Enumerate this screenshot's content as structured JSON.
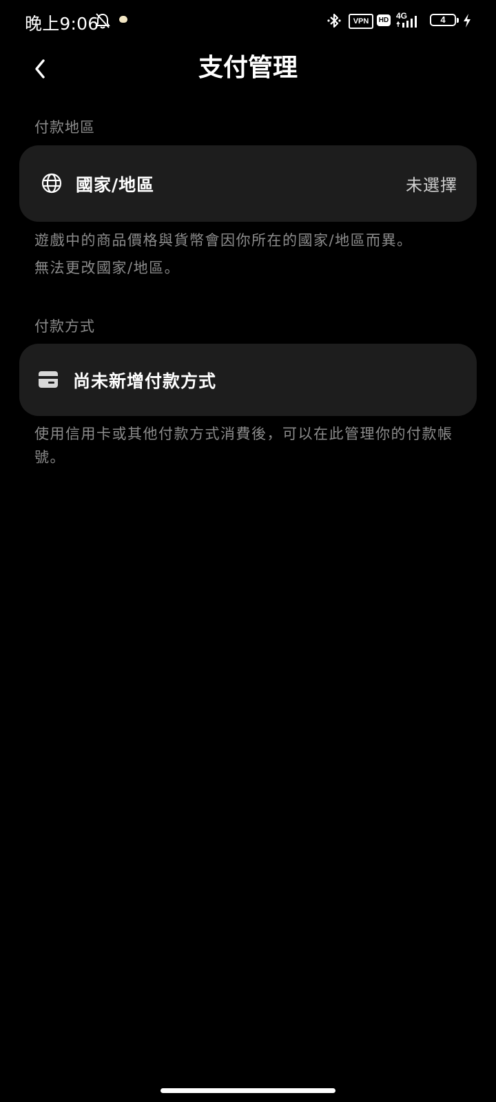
{
  "status_bar": {
    "time": "晚上9:06",
    "vpn": "VPN",
    "hd": "HD",
    "network": "4G",
    "battery": "4",
    "icons": [
      "bell-off-icon",
      "notification-dot-icon",
      "bluetooth-icon",
      "signal-icon",
      "battery-icon",
      "charging-icon"
    ]
  },
  "header": {
    "title": "支付管理",
    "back_icon": "chevron-left-icon"
  },
  "region_section": {
    "label": "付款地區",
    "row_label": "國家/地區",
    "row_value": "未選擇",
    "row_icon": "globe-icon",
    "helper": "遊戲中的商品價格與貨幣會因你所在的國家/地區而異。",
    "helper2": "無法更改國家/地區。"
  },
  "payment_section": {
    "label": "付款方式",
    "row_label": "尚未新增付款方式",
    "row_icon": "card-icon",
    "helper": "使用信用卡或其他付款方式消費後，可以在此管理你的付款帳號。"
  },
  "colors": {
    "background": "#000000",
    "card": "#1d1d1d",
    "secondary_text": "#8c8c8c"
  }
}
